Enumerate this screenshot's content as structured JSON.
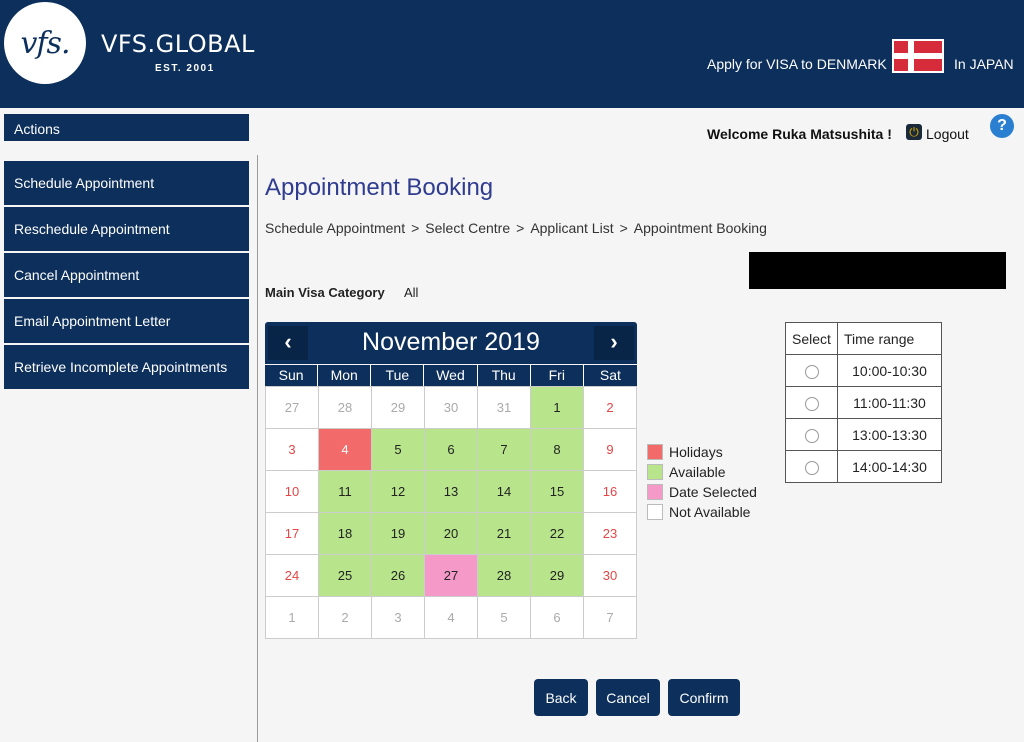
{
  "header": {
    "logo_text": "vfs.",
    "brand": "VFS.GLOBAL",
    "est": "EST. 2001",
    "apply_text": "Apply for VISA to DENMARK",
    "country_suffix": "In JAPAN",
    "flag_colors": [
      "#d52b3a",
      "#ffffff"
    ]
  },
  "sidebar": {
    "heading": "Actions",
    "items": [
      {
        "label": "Schedule Appointment"
      },
      {
        "label": "Reschedule Appointment"
      },
      {
        "label": "Cancel Appointment"
      },
      {
        "label": "Email Appointment Letter"
      },
      {
        "label": "Retrieve Incomplete Appointments"
      }
    ]
  },
  "user": {
    "welcome": "Welcome Ruka Matsushita !",
    "logout": "Logout",
    "help": "?"
  },
  "page": {
    "title": "Appointment Booking",
    "breadcrumbs": [
      "Schedule Appointment",
      "Select Centre",
      "Applicant List",
      "Appointment Booking"
    ],
    "breadcrumb_sep": ">",
    "main_visa_category_label": "Main Visa Category",
    "main_visa_category_value": "All"
  },
  "calendar": {
    "month": "November 2019",
    "prev": "‹",
    "next": "›",
    "weekdays": [
      "Sun",
      "Mon",
      "Tue",
      "Wed",
      "Thu",
      "Fri",
      "Sat"
    ],
    "days": [
      {
        "d": "27",
        "s": "na"
      },
      {
        "d": "28",
        "s": "na"
      },
      {
        "d": "29",
        "s": "na"
      },
      {
        "d": "30",
        "s": "na"
      },
      {
        "d": "31",
        "s": "na"
      },
      {
        "d": "1",
        "s": "avail"
      },
      {
        "d": "2",
        "s": "weekend"
      },
      {
        "d": "3",
        "s": "weekend"
      },
      {
        "d": "4",
        "s": "holiday"
      },
      {
        "d": "5",
        "s": "avail"
      },
      {
        "d": "6",
        "s": "avail"
      },
      {
        "d": "7",
        "s": "avail"
      },
      {
        "d": "8",
        "s": "avail"
      },
      {
        "d": "9",
        "s": "weekend"
      },
      {
        "d": "10",
        "s": "weekend"
      },
      {
        "d": "11",
        "s": "avail"
      },
      {
        "d": "12",
        "s": "avail"
      },
      {
        "d": "13",
        "s": "avail"
      },
      {
        "d": "14",
        "s": "avail"
      },
      {
        "d": "15",
        "s": "avail"
      },
      {
        "d": "16",
        "s": "weekend"
      },
      {
        "d": "17",
        "s": "weekend"
      },
      {
        "d": "18",
        "s": "avail"
      },
      {
        "d": "19",
        "s": "avail"
      },
      {
        "d": "20",
        "s": "avail"
      },
      {
        "d": "21",
        "s": "avail"
      },
      {
        "d": "22",
        "s": "avail"
      },
      {
        "d": "23",
        "s": "weekend"
      },
      {
        "d": "24",
        "s": "weekend"
      },
      {
        "d": "25",
        "s": "avail"
      },
      {
        "d": "26",
        "s": "avail"
      },
      {
        "d": "27",
        "s": "selected"
      },
      {
        "d": "28",
        "s": "avail"
      },
      {
        "d": "29",
        "s": "avail"
      },
      {
        "d": "30",
        "s": "weekend"
      },
      {
        "d": "1",
        "s": "na"
      },
      {
        "d": "2",
        "s": "na"
      },
      {
        "d": "3",
        "s": "na"
      },
      {
        "d": "4",
        "s": "na"
      },
      {
        "d": "5",
        "s": "na"
      },
      {
        "d": "6",
        "s": "na"
      },
      {
        "d": "7",
        "s": "na"
      }
    ]
  },
  "legend": [
    {
      "label": "Holidays",
      "color": "#f26a6a"
    },
    {
      "label": "Available",
      "color": "#b8e58c"
    },
    {
      "label": "Date Selected",
      "color": "#f59ac8"
    },
    {
      "label": "Not Available",
      "color": "#ffffff"
    }
  ],
  "time_table": {
    "col_select": "Select",
    "col_range": "Time range",
    "slots": [
      "10:00-10:30",
      "11:00-11:30",
      "13:00-13:30",
      "14:00-14:30"
    ]
  },
  "buttons": {
    "back": "Back",
    "cancel": "Cancel",
    "confirm": "Confirm"
  },
  "colors": {
    "primary": "#0c2f5b",
    "title": "#2f3c8f"
  }
}
